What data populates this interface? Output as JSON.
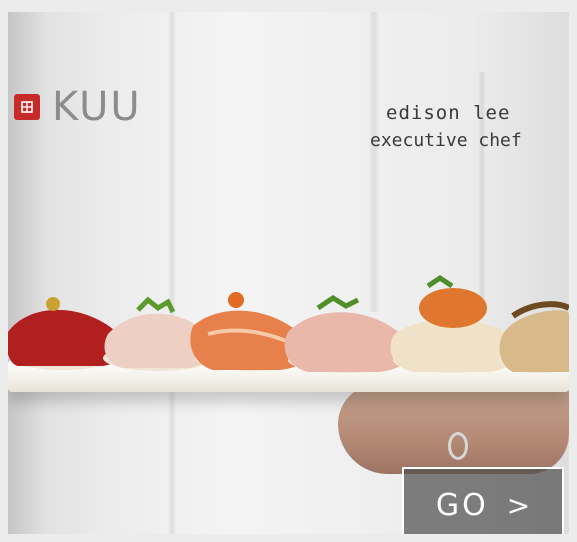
{
  "ad": {
    "brand": "KUU",
    "chef_name": "edison lee",
    "chef_title": "executive chef",
    "cta_label": "GO",
    "cta_arrow": ">"
  },
  "icons": {
    "logo_mark": "red-square-logo-icon",
    "cta_arrow": "chevron-right-icon"
  },
  "colors": {
    "brand_red": "#c82a2a",
    "button_bg": "#505050",
    "button_border": "#ffffff"
  }
}
